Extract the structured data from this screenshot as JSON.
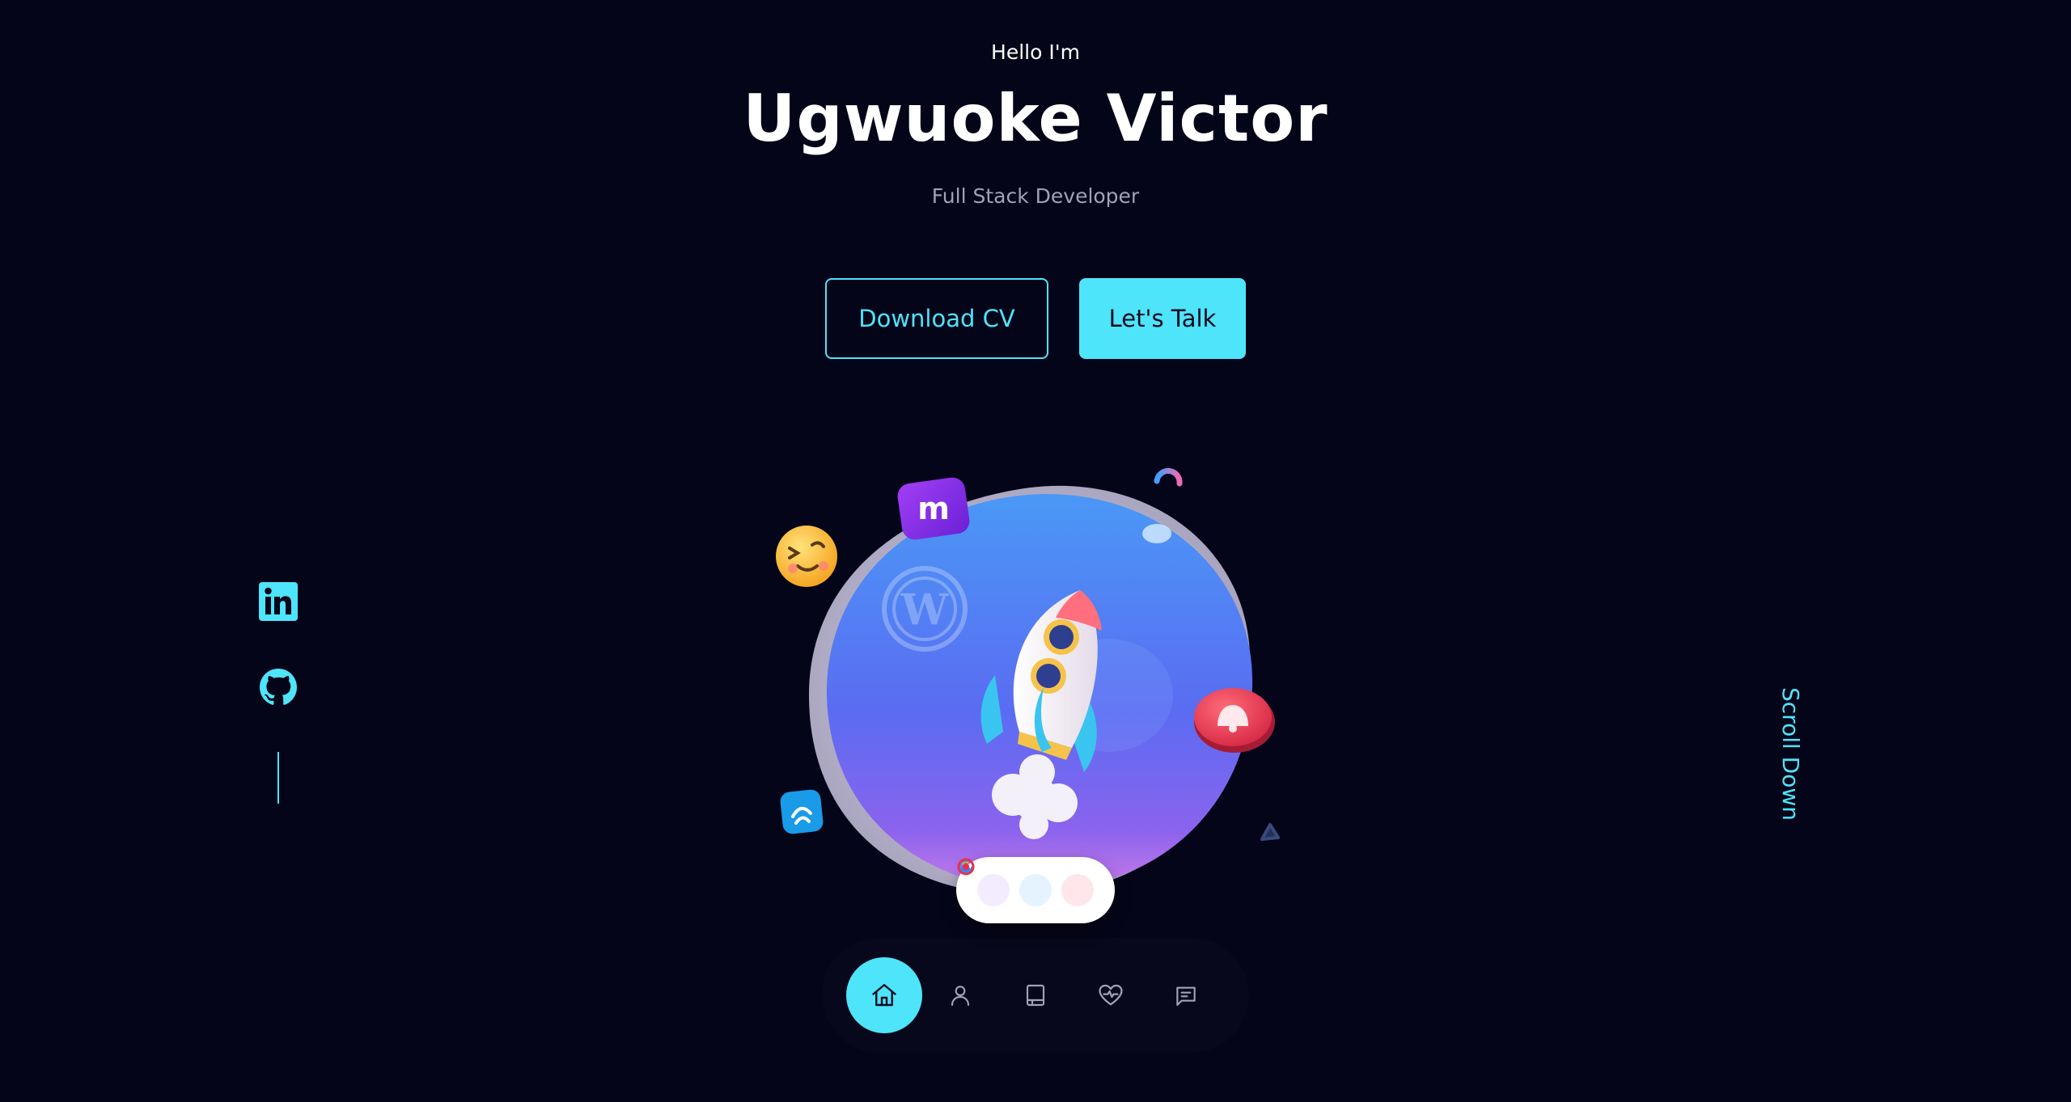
{
  "hero": {
    "greeting": "Hello I'm",
    "name": "Ugwuoke Victor",
    "role": "Full Stack Developer"
  },
  "actions": {
    "download_label": "Download CV",
    "talk_label": "Let's Talk"
  },
  "socials": {
    "items": [
      {
        "name": "linkedin",
        "icon": "linkedin-icon"
      },
      {
        "name": "github",
        "icon": "github-icon"
      }
    ]
  },
  "scroll": {
    "label": "Scroll Down"
  },
  "nav": {
    "items": [
      {
        "name": "home",
        "icon": "home-icon",
        "active": true
      },
      {
        "name": "about",
        "icon": "user-icon",
        "active": false
      },
      {
        "name": "experience",
        "icon": "book-icon",
        "active": false
      },
      {
        "name": "services",
        "icon": "heart-pulse-icon",
        "active": false
      },
      {
        "name": "contact",
        "icon": "message-icon",
        "active": false
      }
    ]
  },
  "colors": {
    "background": "#050519",
    "accent": "#4ee4f9",
    "text_muted": "#a2a2b4"
  }
}
